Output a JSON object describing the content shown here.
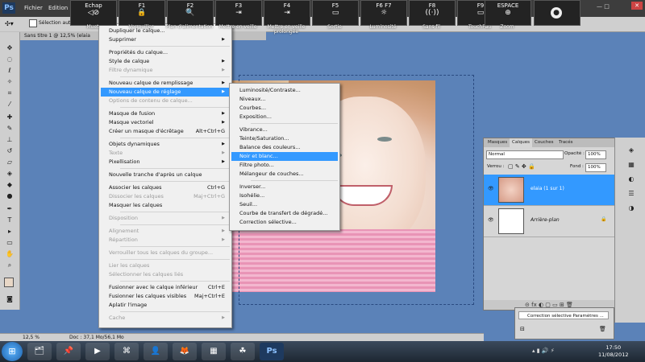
{
  "app": {
    "logo": "Ps",
    "menubar": [
      "Fichier",
      "Edition"
    ],
    "options_checkbox_label": "Sélection auto",
    "doc_tab": "Sans titre 1 @ 12,5% (elaia",
    "window_controls": "— □",
    "close_glyph": "✕"
  },
  "fkeys": [
    {
      "key": "Echap",
      "glyph": "◁⊘",
      "caption": "Muet",
      "icon": "mute-icon"
    },
    {
      "key": "F1",
      "glyph": "🔒",
      "caption": "Verrouiller",
      "icon": "lock-icon"
    },
    {
      "key": "F2",
      "glyph": "🔍",
      "caption": "Plan d'alimentation",
      "icon": "power-plan-icon"
    },
    {
      "key": "F3",
      "glyph": "⇥",
      "caption": "Mettre en veille",
      "icon": "sleep-icon"
    },
    {
      "key": "F4",
      "glyph": "⇥",
      "caption": "Mettre en veille prolongée",
      "icon": "hibernate-icon"
    },
    {
      "key": "F5",
      "glyph": "▭",
      "caption": "Sortie",
      "icon": "display-icon"
    },
    {
      "key": "F6   F7",
      "glyph": "☼",
      "caption": "Luminosité",
      "icon": "brightness-icon"
    },
    {
      "key": "F8",
      "glyph": "((·))",
      "caption": "Sans fil",
      "icon": "wireless-icon"
    },
    {
      "key": "F9",
      "glyph": "▭",
      "caption": "TouchPad",
      "icon": "touchpad-icon"
    },
    {
      "key": "ESPACE",
      "glyph": "⊕",
      "caption": "Zoom",
      "icon": "zoom-icon"
    }
  ],
  "layer_menu": [
    {
      "label": "Dupliquer le calque...",
      "dis": false
    },
    {
      "label": "Supprimer",
      "dis": false,
      "arrow": true
    },
    {
      "sep": true
    },
    {
      "label": "Propriétés du calque...",
      "dis": false
    },
    {
      "label": "Style de calque",
      "dis": false,
      "arrow": true
    },
    {
      "label": "Filtre dynamique",
      "dis": true,
      "arrow": true
    },
    {
      "sep": true
    },
    {
      "label": "Nouveau calque de remplissage",
      "dis": false,
      "arrow": true
    },
    {
      "label": "Nouveau calque de réglage",
      "hl": true,
      "arrow": true
    },
    {
      "label": "Options de contenu de calque...",
      "dis": true
    },
    {
      "sep": true
    },
    {
      "label": "Masque de fusion",
      "dis": false,
      "arrow": true
    },
    {
      "label": "Masque vectoriel",
      "dis": false,
      "arrow": true
    },
    {
      "label": "Créer un masque d'écrêtage",
      "dis": false,
      "sc": "Alt+Ctrl+G"
    },
    {
      "sep": true
    },
    {
      "label": "Objets dynamiques",
      "dis": false,
      "arrow": true
    },
    {
      "label": "Texte",
      "dis": true,
      "arrow": true
    },
    {
      "label": "Pixellisation",
      "dis": false,
      "arrow": true
    },
    {
      "sep": true
    },
    {
      "label": "Nouvelle tranche d'après un calque",
      "dis": false
    },
    {
      "sep": true
    },
    {
      "label": "Associer les calques",
      "dis": false,
      "sc": "Ctrl+G"
    },
    {
      "label": "Dissocier les calques",
      "dis": true,
      "sc": "Maj+Ctrl+G"
    },
    {
      "label": "Masquer les calques",
      "dis": false
    },
    {
      "sep": true
    },
    {
      "label": "Disposition",
      "dis": true,
      "arrow": true
    },
    {
      "sep": true
    },
    {
      "label": "Alignement",
      "dis": true,
      "arrow": true
    },
    {
      "label": "Répartition",
      "dis": true,
      "arrow": true
    },
    {
      "sep": true
    },
    {
      "label": "Verrouiller tous les calques du groupe...",
      "dis": true
    },
    {
      "sep": true
    },
    {
      "label": "Lier les calques",
      "dis": true
    },
    {
      "label": "Sélectionner les calques liés",
      "dis": true
    },
    {
      "sep": true
    },
    {
      "label": "Fusionner avec le calque inférieur",
      "dis": false,
      "sc": "Ctrl+E"
    },
    {
      "label": "Fusionner les calques visibles",
      "dis": false,
      "sc": "Maj+Ctrl+E"
    },
    {
      "label": "Aplatir l'image",
      "dis": false
    },
    {
      "sep": true
    },
    {
      "label": "Cache",
      "dis": true,
      "arrow": true
    }
  ],
  "adjust_menu": [
    {
      "label": "Luminosité/Contraste..."
    },
    {
      "label": "Niveaux..."
    },
    {
      "label": "Courbes..."
    },
    {
      "label": "Exposition..."
    },
    {
      "sep": true
    },
    {
      "label": "Vibrance..."
    },
    {
      "label": "Teinte/Saturation..."
    },
    {
      "label": "Balance des couleurs..."
    },
    {
      "label": "Noir et blanc...",
      "hl": true
    },
    {
      "label": "Filtre photo..."
    },
    {
      "label": "Mélangeur de couches..."
    },
    {
      "sep": true
    },
    {
      "label": "Inverser..."
    },
    {
      "label": "Isohélie..."
    },
    {
      "label": "Seuil..."
    },
    {
      "label": "Courbe de transfert de dégradé..."
    },
    {
      "label": "Correction sélective..."
    }
  ],
  "layers_panel": {
    "tabs": [
      "Masques",
      "Calques",
      "Couches",
      "Tracés"
    ],
    "active_tab": 1,
    "blend_mode": "Normal",
    "opacity_label": "Opacité :",
    "opacity_value": "100%",
    "lock_label": "Verrou :",
    "fill_label": "Fond :",
    "fill_value": "100%",
    "layers": [
      {
        "name": "elaia (1 sur 1)",
        "selected": true
      },
      {
        "name": "Arrière-plan",
        "selected": false
      }
    ],
    "footer_icons": "⊝ fx ◐ ▢ ▭ ⊞ 🗑"
  },
  "history": {
    "item": "Correction sélective Paramètres ..."
  },
  "status": {
    "zoom": "12,5 %",
    "doc": "Doc : 37,1 Mo/56,1 Mo"
  },
  "taskbar": {
    "start_glyph": "⊞",
    "items": [
      "🗂",
      "📌",
      "▶",
      "⌘",
      "👤",
      "🦊",
      "▦",
      "☘",
      "Ps"
    ],
    "time": "17:50",
    "date": "11/08/2012"
  },
  "colors": {
    "highlight": "#3399ff",
    "canvas_bg": "#5b82b8"
  }
}
